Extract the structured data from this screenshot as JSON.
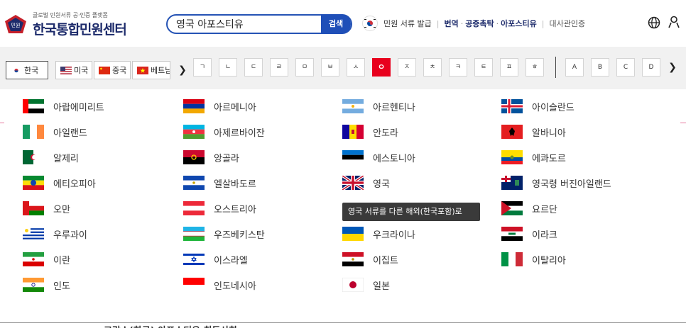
{
  "header": {
    "logo_tag": "글로벌 민원서류 공·인증 플랫폼",
    "logo_name": "한국통합민원센터",
    "logo_badge": "민원",
    "search_value": "영국 아포스티유",
    "search_button": "검색",
    "services": {
      "issue": "민원 서류 발급",
      "translate": "번역",
      "notary": "공증촉탁",
      "apostille": "아포스티유",
      "consular": "대사관인증"
    }
  },
  "filter": {
    "lang_tabs": [
      {
        "label": "한국",
        "flag": "kr",
        "active": true
      },
      {
        "label": "미국",
        "flag": "us",
        "active": false
      },
      {
        "label": "중국",
        "flag": "cn",
        "active": false
      },
      {
        "label": "베트남",
        "flag": "vn",
        "active": false
      }
    ],
    "consonants": [
      "ㄱ",
      "ㄴ",
      "ㄷ",
      "ㄹ",
      "ㅁ",
      "ㅂ",
      "ㅅ",
      "ㅇ",
      "ㅈ",
      "ㅊ",
      "ㅋ",
      "ㅌ",
      "ㅍ",
      "ㅎ"
    ],
    "active_consonant": "ㅇ",
    "letters": [
      "A",
      "B",
      "C",
      "D"
    ],
    "prev_arrow": "❯",
    "next_arrow": "❯"
  },
  "countries": [
    [
      "아랍에미리트",
      "아르메니아",
      "아르헨티나",
      "아이슬란드"
    ],
    [
      "아일랜드",
      "아제르바이잔",
      "안도라",
      "알바니아"
    ],
    [
      "알제리",
      "앙골라",
      "에스토니아",
      "에콰도르"
    ],
    [
      "에티오피아",
      "엘살바도르",
      "영국",
      "영국령 버진아일랜드"
    ],
    [
      "오만",
      "오스트리아",
      "",
      "요르단"
    ],
    [
      "우루과이",
      "우즈베키스탄",
      "우크라이나",
      "이라크"
    ],
    [
      "이란",
      "이스라엘",
      "이집트",
      "이탈리아"
    ],
    [
      "인도",
      "인도네시아",
      "일본",
      ""
    ]
  ],
  "tooltip": "영국 서류를 다른 해외(한국포함)로",
  "bottom_text": "고람스(한국) 아포스티유 취득사항",
  "colors": {
    "brand": "#1d2b6b",
    "search_blue": "#1f4fb8",
    "active_red": "#e8001d"
  }
}
